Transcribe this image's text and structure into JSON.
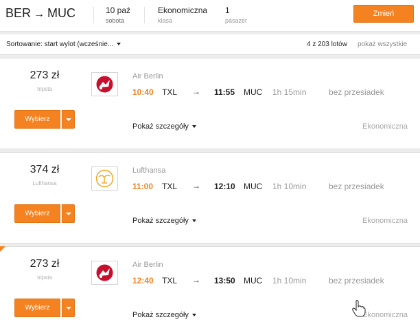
{
  "header": {
    "origin": "BER",
    "destination": "MUC",
    "route_arrow": "→",
    "date_value": "10 paź",
    "date_sub": "sobota",
    "class_value": "Ekonomiczna",
    "class_sub": "klasa",
    "passengers_value": "1",
    "passengers_sub": "pasażer",
    "change_label": "Zmień"
  },
  "sort": {
    "label": "Sortowanie: start wylot (wcześnie...",
    "count": "4 z 203 lotów",
    "show_all": "pokaż wszystkie"
  },
  "colors": {
    "accent": "#f58220",
    "airberlin": "#c8102e",
    "lufthansa": "#f5a623"
  },
  "flights": [
    {
      "price": "273 zł",
      "provider": "tripsta",
      "select_label": "Wybierz",
      "logo_icon": "air-berlin-logo-icon",
      "airline": "Air Berlin",
      "dep_time": "10:40",
      "dep_airport": "TXL",
      "arrow": "→",
      "arr_time": "11:55",
      "arr_airport": "MUC",
      "duration": "1h 15min",
      "stops": "bez przesiadek",
      "details": "Pokaż szczegóły",
      "cabin": "Ekonomiczna"
    },
    {
      "price": "374 zł",
      "provider": "Lufthansa",
      "select_label": "Wybierz",
      "logo_icon": "lufthansa-crane-logo-icon",
      "airline": "Lufthansa",
      "dep_time": "11:00",
      "dep_airport": "TXL",
      "arrow": "→",
      "arr_time": "12:10",
      "arr_airport": "MUC",
      "duration": "1h 10min",
      "stops": "bez przesiadek",
      "details": "Pokaż szczegóły",
      "cabin": "Ekonomiczna"
    },
    {
      "price": "273 zł",
      "provider": "tripsta",
      "select_label": "Wybierz",
      "logo_icon": "air-berlin-logo-icon",
      "airline": "Air Berlin",
      "dep_time": "12:40",
      "dep_airport": "TXL",
      "arrow": "→",
      "arr_time": "13:50",
      "arr_airport": "MUC",
      "duration": "1h 10min",
      "stops": "bez przesiadek",
      "details": "Pokaż szczegóły",
      "cabin": "Ekonomiczna"
    }
  ]
}
